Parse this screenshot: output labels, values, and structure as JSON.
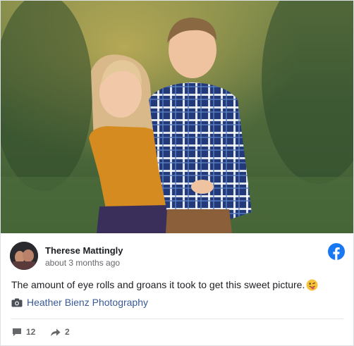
{
  "post": {
    "author": "Therese Mattingly",
    "timestamp": "about 3 months ago",
    "text": "The amount of eye rolls and groans it took to get this sweet picture.",
    "emoji": "winking-face-with-tongue",
    "credit": "Heather Bienz Photography",
    "platform_icon": "facebook-icon"
  },
  "stats": {
    "comments": "12",
    "shares": "2"
  },
  "colors": {
    "link": "#385898",
    "facebook_blue": "#1877f2",
    "meta_text": "#65676b"
  }
}
